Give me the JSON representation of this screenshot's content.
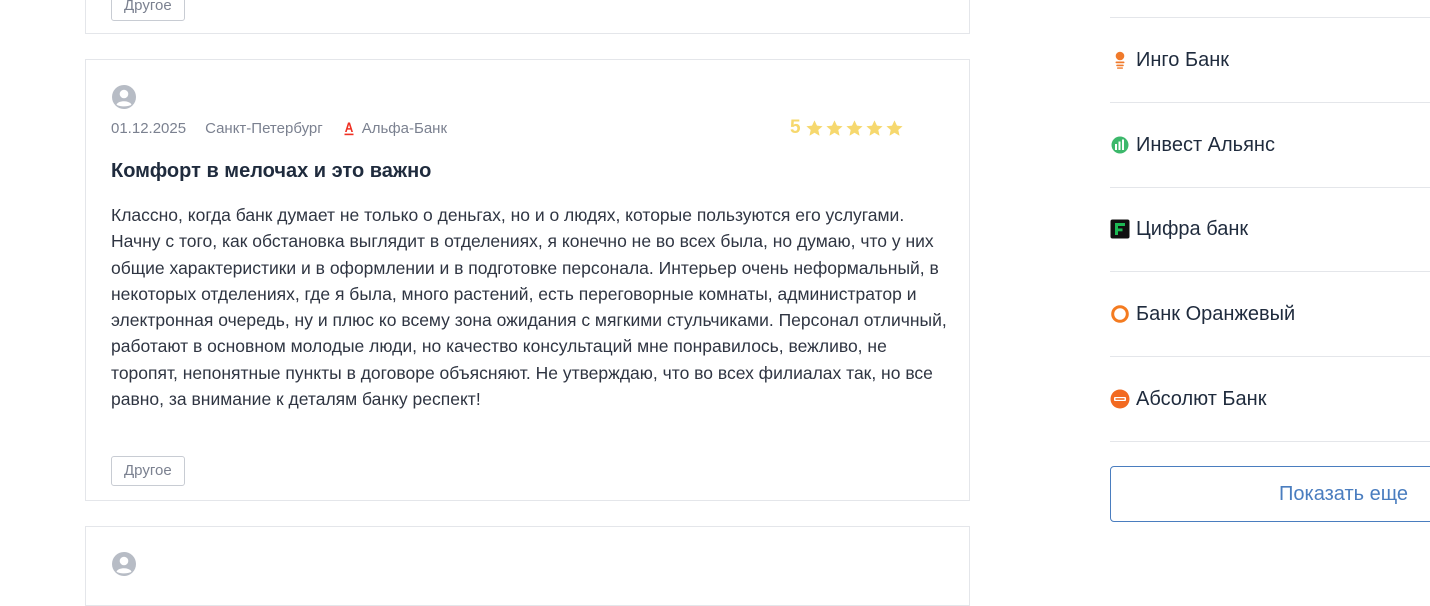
{
  "reviews": [
    {
      "tag": "Другое"
    },
    {
      "date": "01.12.2025",
      "city": "Санкт-Петербург",
      "bank": "Альфа-Банк",
      "rating": "5",
      "stars": 5,
      "title": "Комфорт в мелочах и это важно",
      "body": "Классно, когда банк думает не только о деньгах, но и о людях, которые пользуются его услугами. Начну с того, как обстановка выглядит в отделениях, я конечно не во всех была, но думаю, что у них общие характеристики и в оформлении и в подготовке персонала. Интерьер очень неформальный, в некоторых отделениях, где я была, много растений, есть переговорные комнаты, администратор и электронная очередь, ну и плюс ко всему зона ожидания с мягкими стульчиками. Персонал отличный, работают в основном молодые люди, но качество консультаций мне понравилось, вежливо, не торопят, непонятные пункты в договоре объясняют. Не утверждаю, что во всех филиалах так, но все равно, за внимание к деталям банку респект!",
      "tag": "Другое"
    }
  ],
  "sidebar": {
    "items": [
      {
        "label": "Инго Банк",
        "icon": "ingo-bank-logo-icon",
        "color": "#f07a2b"
      },
      {
        "label": "Инвест Альянс",
        "icon": "invest-alyans-logo-icon",
        "color": "#3cb86b"
      },
      {
        "label": "Цифра банк",
        "icon": "cifra-bank-logo-icon",
        "color": "#1db954"
      },
      {
        "label": "Банк Оранжевый",
        "icon": "bank-oranzhevyy-logo-icon",
        "color": "#f47b20"
      },
      {
        "label": "Абсолют Банк",
        "icon": "absolut-bank-logo-icon",
        "color": "#f26a21"
      }
    ],
    "show_more": "Показать еще"
  },
  "colors": {
    "star": "#f6d86e",
    "link": "#4a7dbf",
    "alfa": "#ef3124"
  }
}
